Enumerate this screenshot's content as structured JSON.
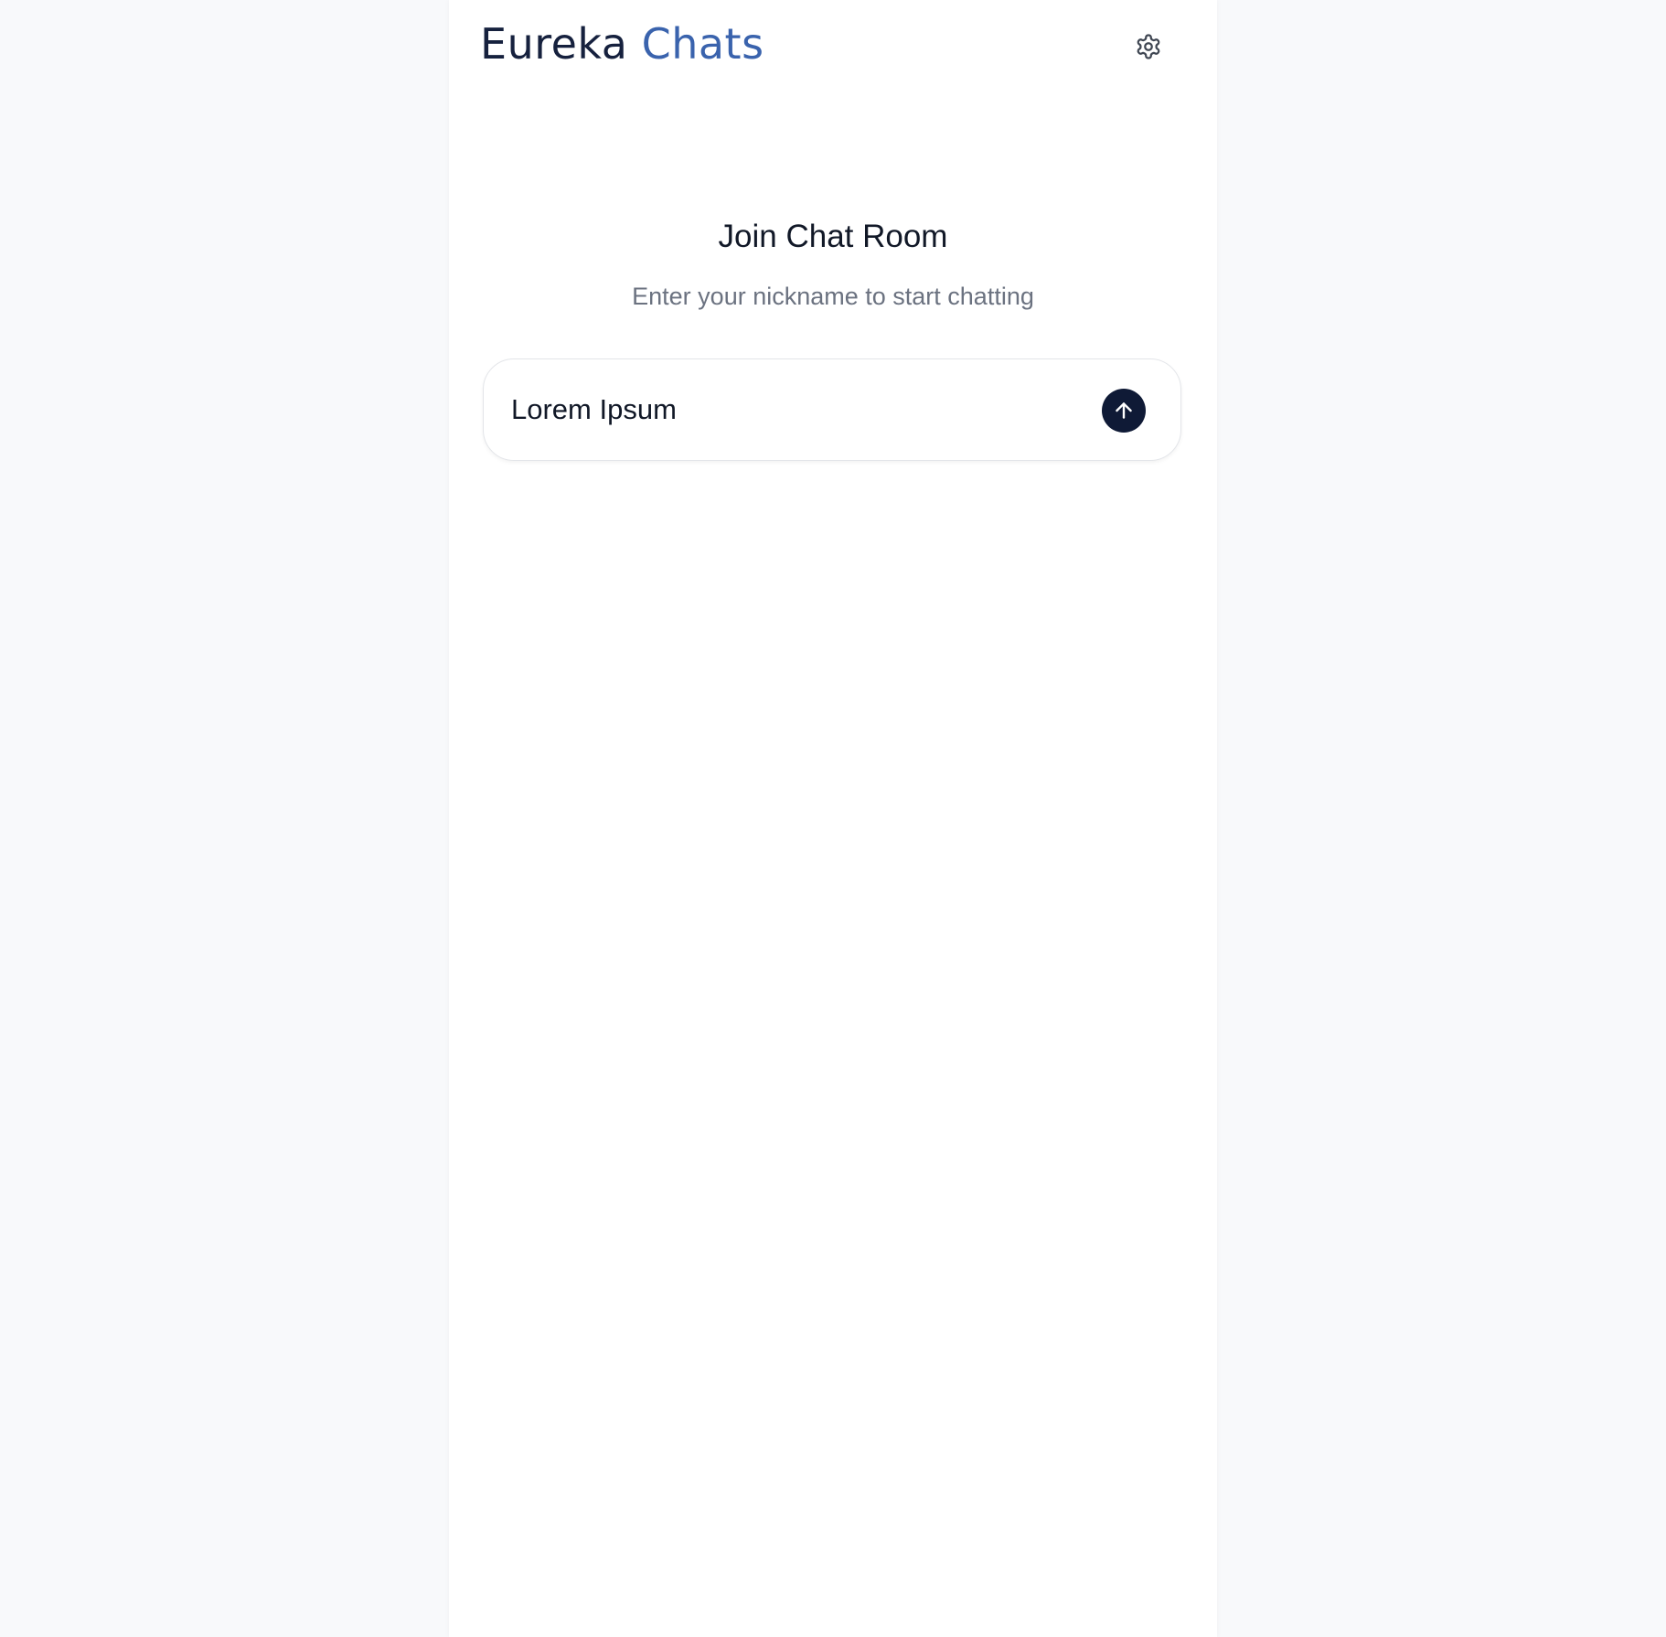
{
  "header": {
    "brand_part1": "Eureka",
    "brand_part2": "Chats",
    "settings_icon": "gear-icon"
  },
  "join": {
    "title": "Join Chat Room",
    "subtitle": "Enter your nickname to start chatting",
    "nickname_value": "Lorem Ipsum",
    "submit_icon": "arrow-up-icon"
  },
  "colors": {
    "brand_dark": "#16213e",
    "brand_accent": "#3a63ad",
    "button_bg": "#0f1a36",
    "subtitle_text": "#6b7280",
    "page_bg": "#f8f9fb"
  }
}
